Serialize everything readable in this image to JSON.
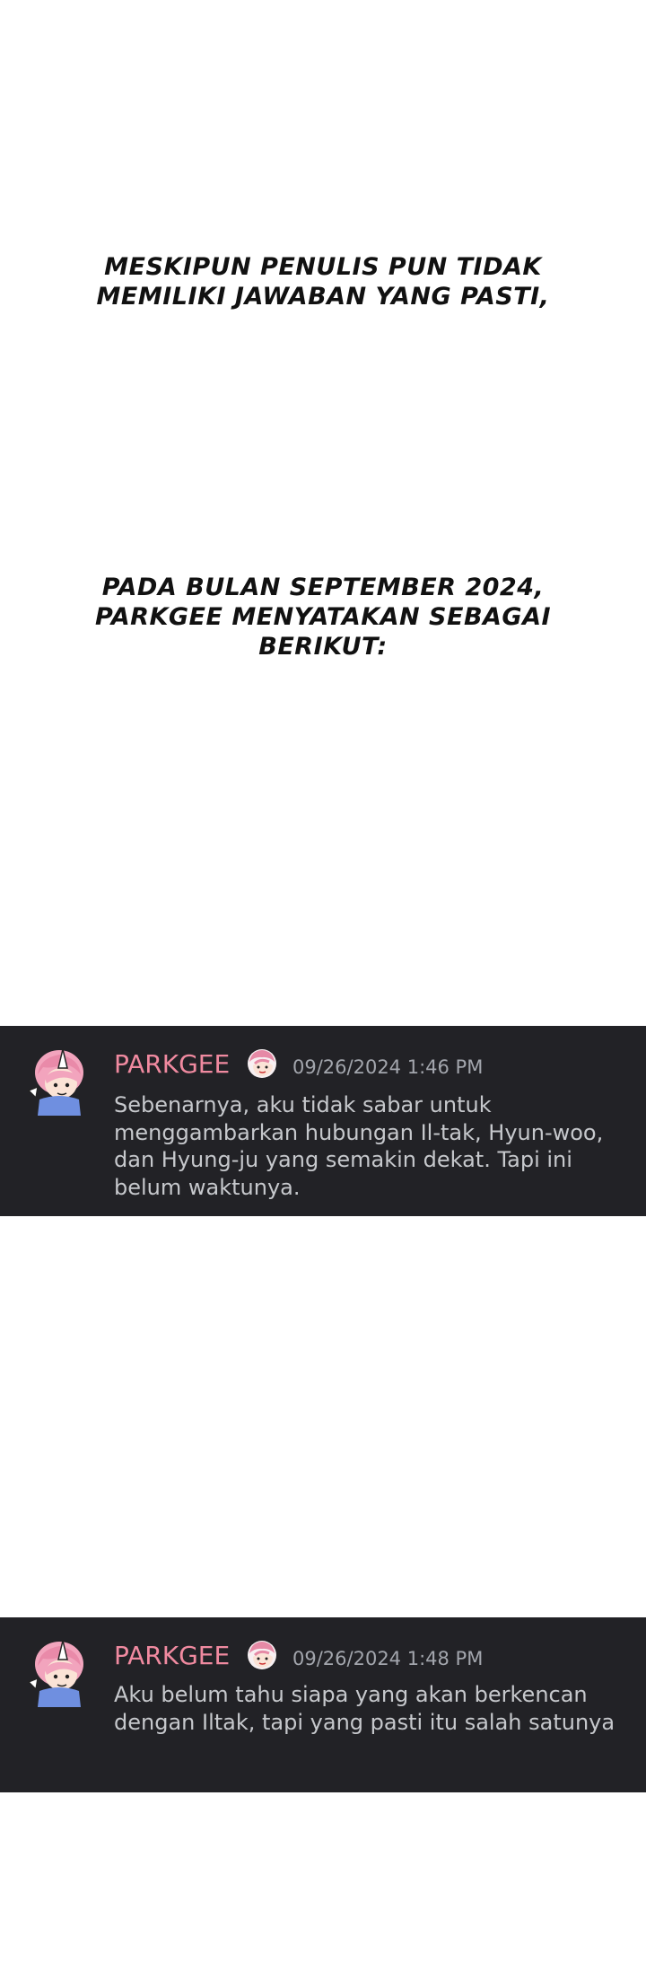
{
  "captions": [
    {
      "lines": [
        "MESKIPUN PENULIS PUN TIDAK",
        "MEMILIKI JAWABAN YANG PASTI,"
      ]
    },
    {
      "lines": [
        "PADA BULAN SEPTEMBER 2024,",
        "PARKGEE MENYATAKAN SEBAGAI",
        "BERIKUT:"
      ]
    }
  ],
  "messages": [
    {
      "username": "PARKGEE",
      "timestamp": "09/26/2024 1:46 PM",
      "lines": [
        "Sebenarnya, aku tidak sabar untuk",
        "menggambarkan hubungan Il-tak, Hyun-woo,",
        "dan Hyung-ju yang semakin dekat. Tapi ini",
        "belum waktunya."
      ]
    },
    {
      "username": "PARKGEE",
      "timestamp": "09/26/2024 1:48 PM",
      "lines": [
        "Aku belum tahu siapa yang akan berkencan",
        "dengan Iltak, tapi yang pasti itu salah satunya"
      ]
    }
  ],
  "colors": {
    "panel_background": "#222226",
    "username": "#f08aa0",
    "timestamp": "#a3a6ad",
    "message_text": "#c6c8cc",
    "avatar_hair": "#f2a4bd",
    "avatar_shirt": "#6f8fe0"
  },
  "icons": {
    "avatar": "avatar-illustration",
    "badge": "character-head-badge-icon"
  }
}
